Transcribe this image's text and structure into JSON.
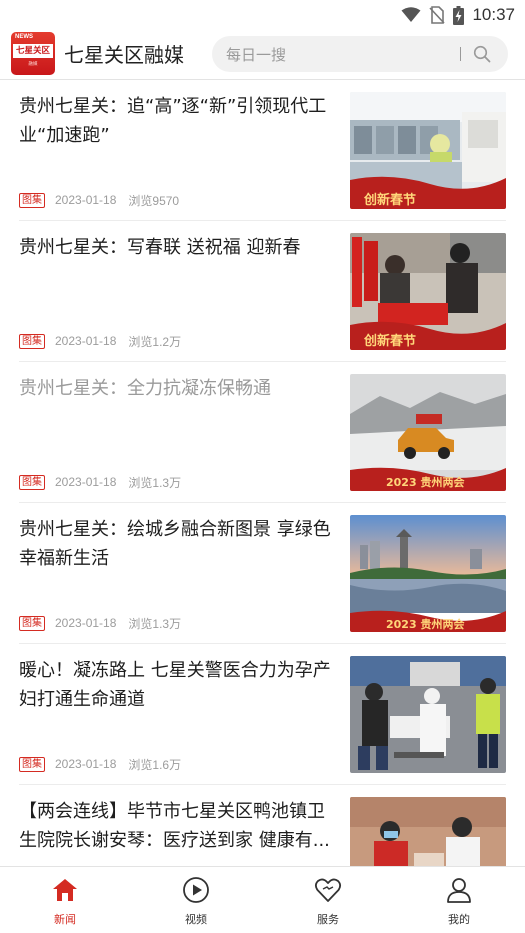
{
  "status_bar": {
    "time": "10:37",
    "icons": [
      "wifi-icon",
      "no-sim-icon",
      "battery-charging-icon"
    ]
  },
  "header": {
    "logo": {
      "top_text": "NEWS",
      "main_text": "七星关区",
      "sub_text": "融媒"
    },
    "app_title": "七星关区融媒",
    "search": {
      "placeholder": "每日一搜",
      "icon": "search-icon"
    }
  },
  "news": [
    {
      "title": "贵州七星关：追“高”逐“新”引领现代工业“加速跑”",
      "tag": "图集",
      "date": "2023-01-18",
      "views": "浏览9570",
      "read": false,
      "thumb_caption": "创新春节"
    },
    {
      "title": "贵州七星关：写春联 送祝福 迎新春",
      "tag": "图集",
      "date": "2023-01-18",
      "views": "浏览1.2万",
      "read": false,
      "thumb_caption": "创新春节"
    },
    {
      "title": "贵州七星关：全力抗凝冻保畅通",
      "tag": "图集",
      "date": "2023-01-18",
      "views": "浏览1.3万",
      "read": true,
      "thumb_caption": "2023 贵州两会"
    },
    {
      "title": "贵州七星关：绘城乡融合新图景 享绿色幸福新生活",
      "tag": "图集",
      "date": "2023-01-18",
      "views": "浏览1.3万",
      "read": false,
      "thumb_caption": "2023 贵州两会"
    },
    {
      "title": "暖心！凝冻路上 七星关警医合力为孕产妇打通生命通道",
      "tag": "图集",
      "date": "2023-01-18",
      "views": "浏览1.6万",
      "read": false
    },
    {
      "title": "【两会连线】毕节市七星关区鸭池镇卫生院院长谢安琴：医疗送到家 健康有...",
      "tag": "",
      "date": "",
      "views": "",
      "read": false
    }
  ],
  "bottom_nav": [
    {
      "label": "新闻",
      "icon": "home-icon",
      "active": true
    },
    {
      "label": "视频",
      "icon": "play-circle-icon",
      "active": false
    },
    {
      "label": "服务",
      "icon": "heart-outline-icon",
      "active": false
    },
    {
      "label": "我的",
      "icon": "user-icon",
      "active": false
    }
  ],
  "colors": {
    "accent": "#d42b22",
    "text": "#1e1e1e",
    "muted": "#9c9c9c"
  }
}
